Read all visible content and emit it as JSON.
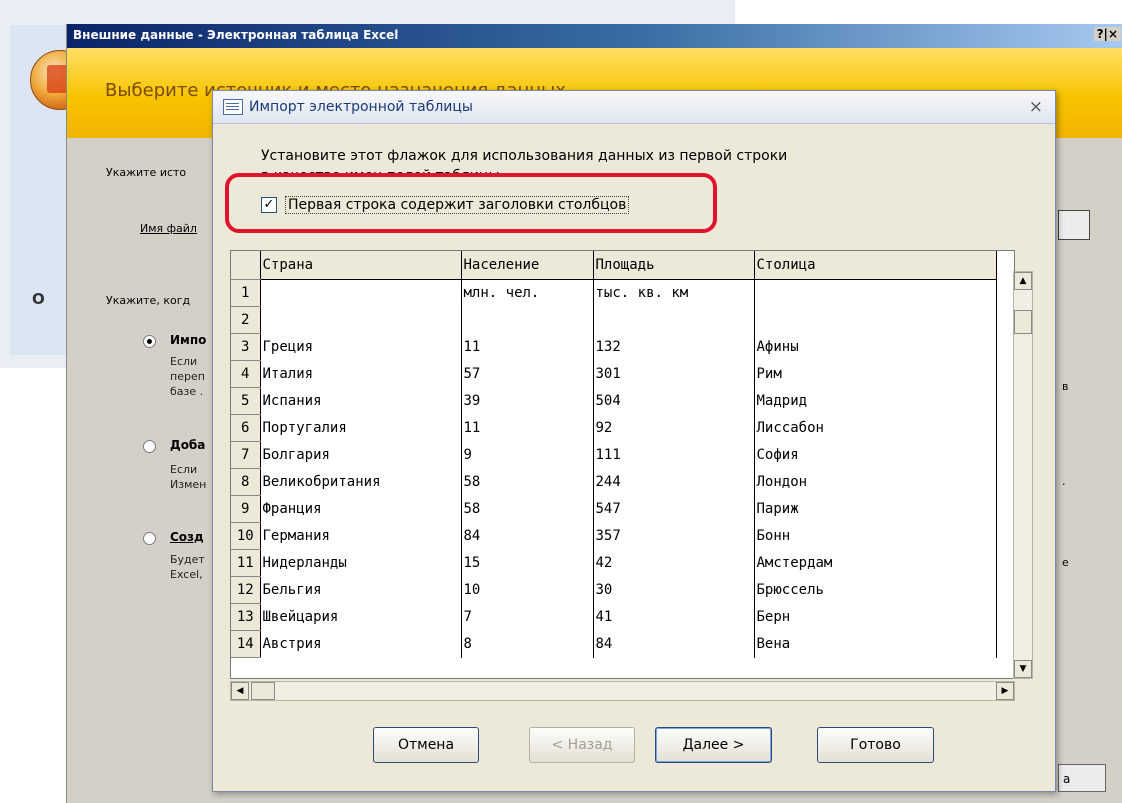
{
  "background": {
    "outer_title": "Внешние данные - Электронная таблица Excel",
    "outer_title_buttons": "?|×",
    "banner_text": "Выберите источник и место назначения данных",
    "side_letter": "O",
    "labels": {
      "source": "Укажите исто",
      "filename": "Имя файл",
      "when": "Укажите, когд",
      "opt_import": "Импо",
      "opt_import_desc": "Если\nпереп\nбазе .",
      "opt_append": "Доба",
      "opt_append_desc": "Если\nИзмен",
      "opt_link": "Созд",
      "opt_link_desc": "Будет\nExcel,",
      "right_frag_1": "в",
      "right_frag_2": ".",
      "right_frag_3": "е",
      "ok_fragment": "а"
    }
  },
  "dialog": {
    "title": "Импорт электронной таблицы",
    "close": "×",
    "instruction_line1": "Установите этот флажок для использования данных из первой строки",
    "instruction_line2": "в качестве имен полей таблицы",
    "checkbox_checked": true,
    "checkbox_mark": "✓",
    "checkbox_label": "Первая строка содержит заголовки столбцов",
    "columns": [
      "Страна",
      "Население",
      "Площадь",
      "Столица"
    ],
    "rows": [
      {
        "n": "1",
        "c": [
          "",
          "млн. чел.",
          "тыс. кв. км",
          ""
        ]
      },
      {
        "n": "2",
        "c": [
          "",
          "",
          "",
          ""
        ]
      },
      {
        "n": "3",
        "c": [
          "Греция",
          "11",
          "132",
          "Афины"
        ]
      },
      {
        "n": "4",
        "c": [
          "Италия",
          "57",
          "301",
          "Рим"
        ]
      },
      {
        "n": "5",
        "c": [
          "Испания",
          "39",
          "504",
          "Мадрид"
        ]
      },
      {
        "n": "6",
        "c": [
          "Португалия",
          "11",
          "92",
          "Лиссабон"
        ]
      },
      {
        "n": "7",
        "c": [
          "Болгария",
          "9",
          "111",
          "София"
        ]
      },
      {
        "n": "8",
        "c": [
          "Великобритания",
          "58",
          "244",
          "Лондон"
        ]
      },
      {
        "n": "9",
        "c": [
          "Франция",
          "58",
          "547",
          "Париж"
        ]
      },
      {
        "n": "10",
        "c": [
          "Германия",
          "84",
          "357",
          "Бонн"
        ]
      },
      {
        "n": "11",
        "c": [
          "Нидерланды",
          "15",
          "42",
          "Амстердам"
        ]
      },
      {
        "n": "12",
        "c": [
          "Бельгия",
          "10",
          "30",
          "Брюссель"
        ]
      },
      {
        "n": "13",
        "c": [
          "Швейцария",
          "7",
          "41",
          "Берн"
        ]
      },
      {
        "n": "14",
        "c": [
          "Австрия",
          "8",
          "84",
          "Вена"
        ]
      }
    ],
    "scroll_up": "▲",
    "scroll_down": "▼",
    "scroll_left": "◀",
    "scroll_right": "▶",
    "buttons": {
      "cancel": "Отмена",
      "back": "< Назад",
      "next": "Далее >",
      "finish": "Готово"
    }
  }
}
